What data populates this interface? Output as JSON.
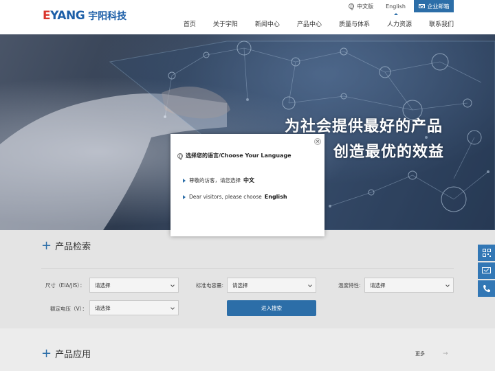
{
  "header": {
    "logo_en_first": "E",
    "logo_en_rest": "YANG",
    "logo_cn": "宇阳科技",
    "lang_cn": "中文版",
    "lang_en": "English",
    "mail": "企业邮箱",
    "nav": [
      "首页",
      "关于宇阳",
      "新闻中心",
      "产品中心",
      "质量与体系",
      "人力资源",
      "联系我们"
    ]
  },
  "banner": {
    "slogan_line1": "为社会提供最好的产品",
    "slogan_line2": "创造最优的效益"
  },
  "modal": {
    "title": "选择您的语言/Choose Your Language",
    "close": "×",
    "row1_text": "尊敬的访客，请您选择",
    "row1_choice": "中文",
    "row2_text": "Dear visitors, please choose",
    "row2_choice": "English"
  },
  "search_section": {
    "title": "产品检索",
    "size_label": "尺寸（EIA/JIS）：",
    "capacity_label": "标准电容量:",
    "temp_label": "温度特性:",
    "voltage_label": "额定电压（V）：",
    "select_placeholder": "请选择",
    "search_button": "进入搜索"
  },
  "application_section": {
    "title": "产品应用",
    "more": "更多",
    "arrow": "→"
  },
  "side": {
    "qr_icon": "qr-icon",
    "chat_icon": "chat-icon",
    "phone_icon": "phone-icon"
  },
  "colors": {
    "brand_blue": "#2c6ea8",
    "logo_red": "#d9342b"
  }
}
